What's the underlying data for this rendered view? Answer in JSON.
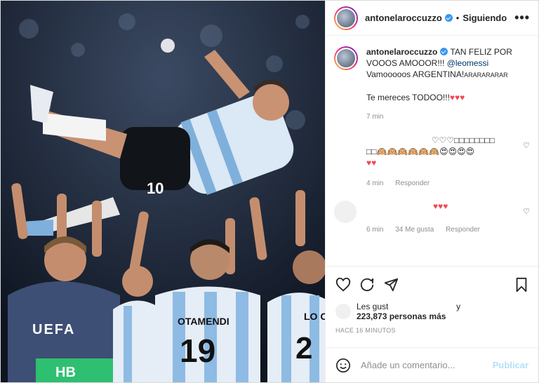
{
  "post": {
    "username": "antonelaroccuzzo",
    "separator": "•",
    "follow_status": "Siguiendo",
    "more": "•••",
    "photo_alt": "Foto de jugadores de Argentina celebrando y lanzando a un compañero al aire",
    "jersey_text": {
      "left_back": "HB",
      "mid_name": "OTAMENDI",
      "mid_number": "19",
      "right_name": "LO C",
      "right_number": "2",
      "center_number": "10",
      "badge": "UEFA"
    }
  },
  "caption": {
    "username": "antonelaroccuzzo",
    "text1": " TAN FELIZ POR VOOOS AMOOOR!!! ",
    "mention": "@leomessi",
    "text2": "Vamooooos ARGENTINA!",
    "text2_small": "ARARARARAR",
    "text3": "Te mereces TODOO!!!",
    "hearts": "♥♥♥",
    "time": "7 min"
  },
  "comments": [
    {
      "line1": "♡♡♡□□□□□□□□",
      "line2": "□□🙉🙉🙉🙉🙉🙉😍😍😍😍",
      "hearts": "♥♥",
      "time": "4 min",
      "reply": "Responder"
    },
    {
      "hearts": "♥♥♥",
      "time": "6 min",
      "likes": "34 Me gusta",
      "reply": "Responder"
    }
  ],
  "likes": {
    "prefix": "Les gust",
    "suffix": "y",
    "count": "223,873 personas más"
  },
  "timestamp": "HACE 16 MINUTOS",
  "composer": {
    "placeholder": "Añade un comentario...",
    "publish": "Publicar"
  }
}
